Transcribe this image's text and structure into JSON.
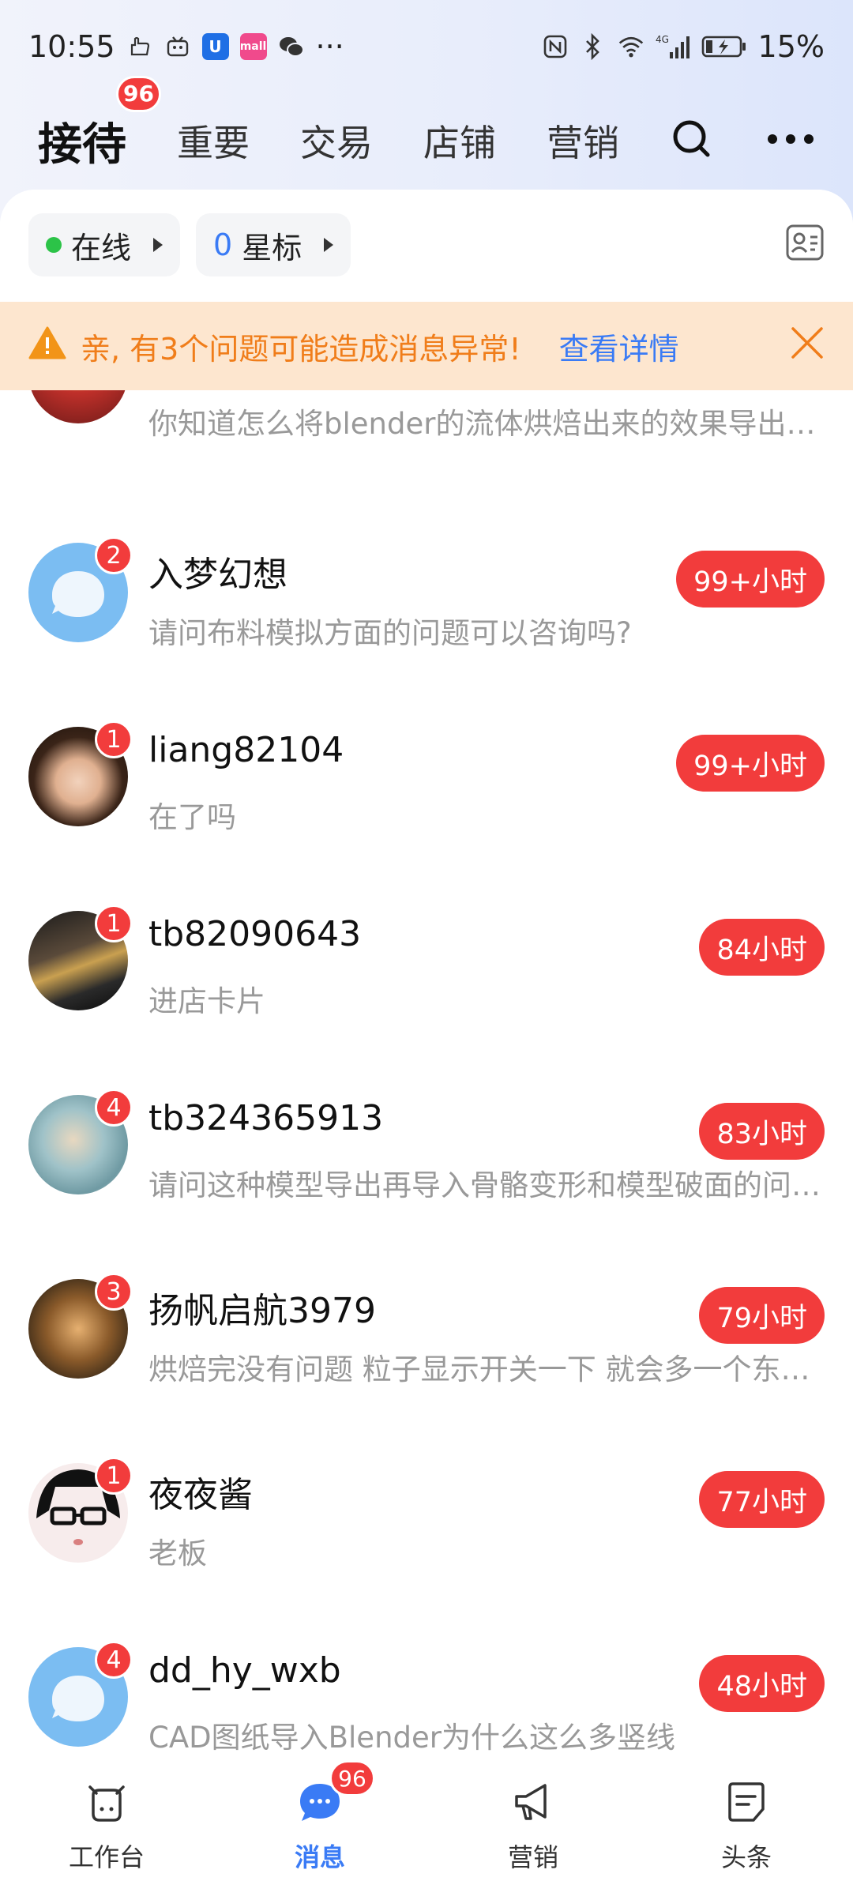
{
  "status_bar": {
    "time": "10:55",
    "more": "···",
    "battery": "15%",
    "network": "4G"
  },
  "header": {
    "tabs": [
      {
        "label": "接待",
        "badge": "96"
      },
      {
        "label": "重要"
      },
      {
        "label": "交易"
      },
      {
        "label": "店铺"
      },
      {
        "label": "营销"
      }
    ]
  },
  "filters": {
    "online_label": "在线",
    "star_count": "0",
    "star_label": "星标"
  },
  "warning": {
    "text": "亲, 有3个问题可能造成消息异常!",
    "link": "查看详情"
  },
  "conversations": [
    {
      "name": "",
      "preview": "你知道怎么将blender的流体烘焙出来的效果导出来吗",
      "time": "",
      "unread": ""
    },
    {
      "name": "入梦幻想",
      "preview": "请问布料模拟方面的问题可以咨询吗?",
      "time": "99+小时",
      "unread": "2"
    },
    {
      "name": "liang82104",
      "preview": "在了吗",
      "time": "99+小时",
      "unread": "1"
    },
    {
      "name": "tb82090643",
      "preview": "进店卡片",
      "time": "84小时",
      "unread": "1"
    },
    {
      "name": "tb324365913",
      "preview": "请问这种模型导出再导入骨骼变形和模型破面的问题怎么解决",
      "time": "83小时",
      "unread": "4"
    },
    {
      "name": "扬帆启航3979",
      "preview": "烘焙完没有问题 粒子显示开关一下 就会多一个东西出来",
      "time": "79小时",
      "unread": "3"
    },
    {
      "name": "夜夜酱",
      "preview": "老板",
      "time": "77小时",
      "unread": "1"
    },
    {
      "name": "dd_hy_wxb",
      "preview": "CAD图纸导入Blender为什么这么多竖线",
      "time": "48小时",
      "unread": "4"
    }
  ],
  "bottom_nav": [
    {
      "label": "工作台"
    },
    {
      "label": "消息",
      "badge": "96"
    },
    {
      "label": "营销"
    },
    {
      "label": "头条"
    }
  ],
  "colors": {
    "accent": "#3a7bf5",
    "badge_red": "#f23c3c",
    "warning_bg": "#fde6cf",
    "warning_text": "#f07d1a",
    "online_green": "#2cc348"
  }
}
